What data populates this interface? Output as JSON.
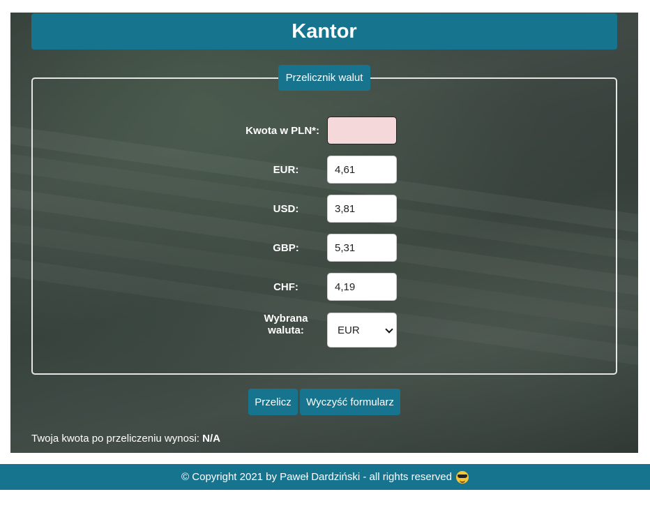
{
  "header": {
    "title": "Kantor"
  },
  "form": {
    "legend": "Przelicznik walut",
    "amount": {
      "label": "Kwota w PLN*:",
      "value": ""
    },
    "rates": [
      {
        "label": "EUR:",
        "value": "4,61"
      },
      {
        "label": "USD:",
        "value": "3,81"
      },
      {
        "label": "GBP:",
        "value": "5,31"
      },
      {
        "label": "CHF:",
        "value": "4,19"
      }
    ],
    "currency": {
      "label_line1": "Wybrana",
      "label_line2": "waluta:",
      "selected": "EUR"
    }
  },
  "buttons": {
    "calculate": "Przelicz",
    "clear": "Wyczyść formularz"
  },
  "result": {
    "prefix": "Twoja kwota po przeliczeniu wynosi:",
    "value": "N/A"
  },
  "footer": {
    "text": "© Copyright 2021 by Paweł Dardziński - all rights reserved"
  },
  "colors": {
    "accent": "#17748f",
    "invalid_input": "#f5d8da"
  }
}
